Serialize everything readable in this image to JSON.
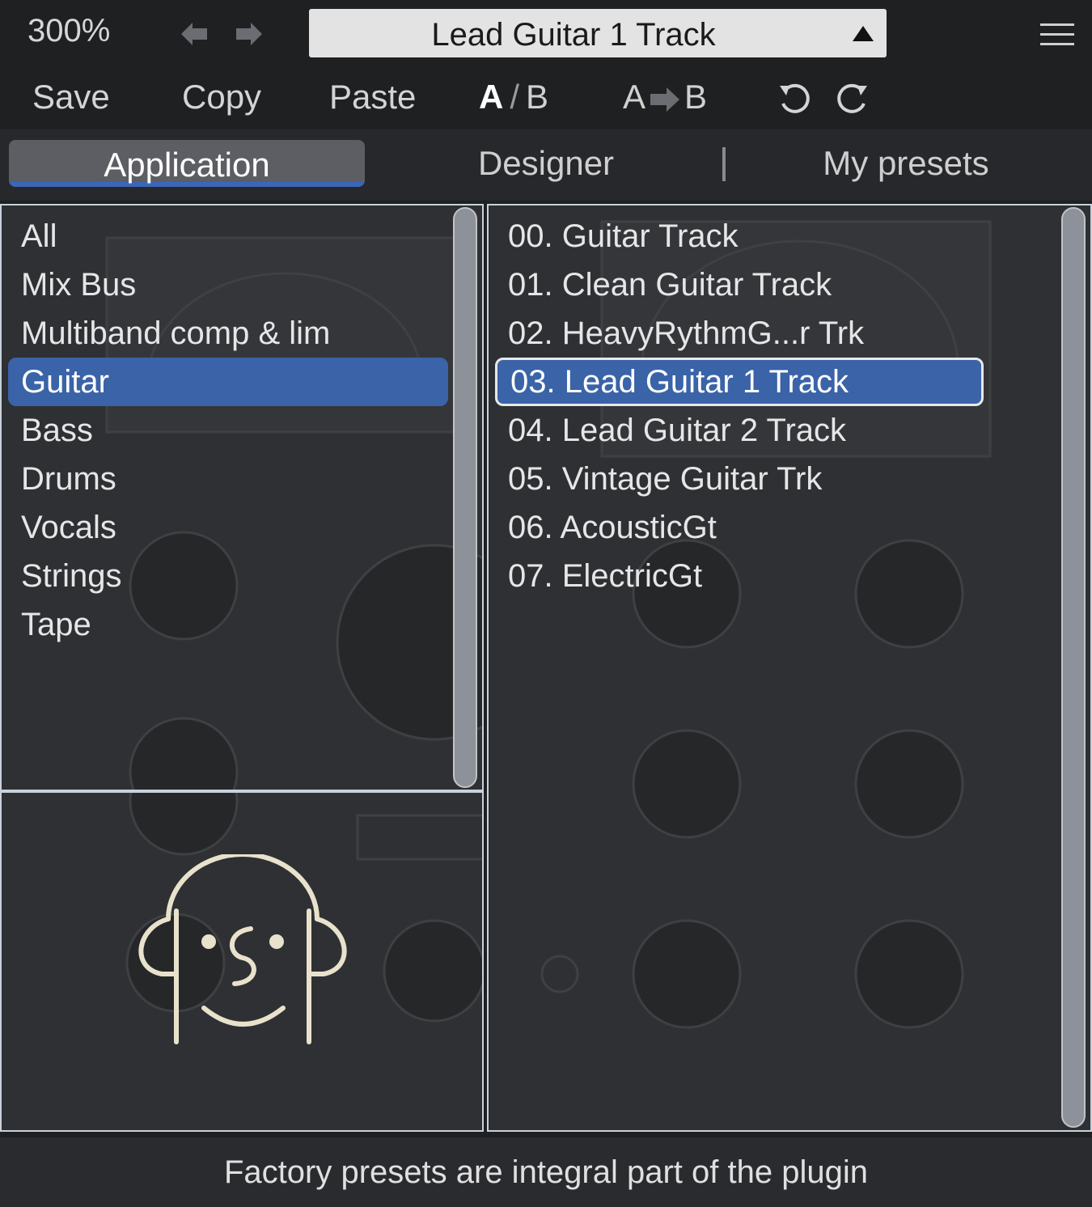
{
  "header": {
    "zoom": "300%",
    "preset_name": "Lead Guitar 1 Track",
    "back_icon": "arrow-left-icon",
    "forward_icon": "arrow-right-icon",
    "menu_icon": "hamburger-menu-icon"
  },
  "toolbar": {
    "save": "Save",
    "copy": "Copy",
    "paste": "Paste",
    "a_label": "A",
    "slash": "/",
    "b_label": "B",
    "copy_a": "A",
    "copy_b": "B",
    "undo_icon": "undo-icon",
    "redo_icon": "redo-icon"
  },
  "tabs": {
    "application": "Application",
    "designer": "Designer",
    "my_presets": "My presets"
  },
  "categories": [
    "All",
    "Mix Bus",
    "Multiband comp & lim",
    "Guitar",
    "Bass",
    "Drums",
    "Vocals",
    "Strings",
    "Tape"
  ],
  "selected_category": "Guitar",
  "presets": [
    "00. Guitar Track",
    "01. Clean Guitar Track",
    "02. HeavyRythmG...r Trk",
    "03. Lead Guitar 1 Track",
    "04. Lead Guitar 2 Track",
    "05. Vintage Guitar Trk",
    "06. AcousticGt",
    "07. ElectricGt"
  ],
  "selected_preset": "03. Lead Guitar 1 Track",
  "status": {
    "message": "Factory presets are integral part of the plugin"
  },
  "colors": {
    "background": "#1f2022",
    "selection": "#3a63a8",
    "tab_underline": "#3c67b8",
    "preset_box": "#e3e3e3"
  }
}
